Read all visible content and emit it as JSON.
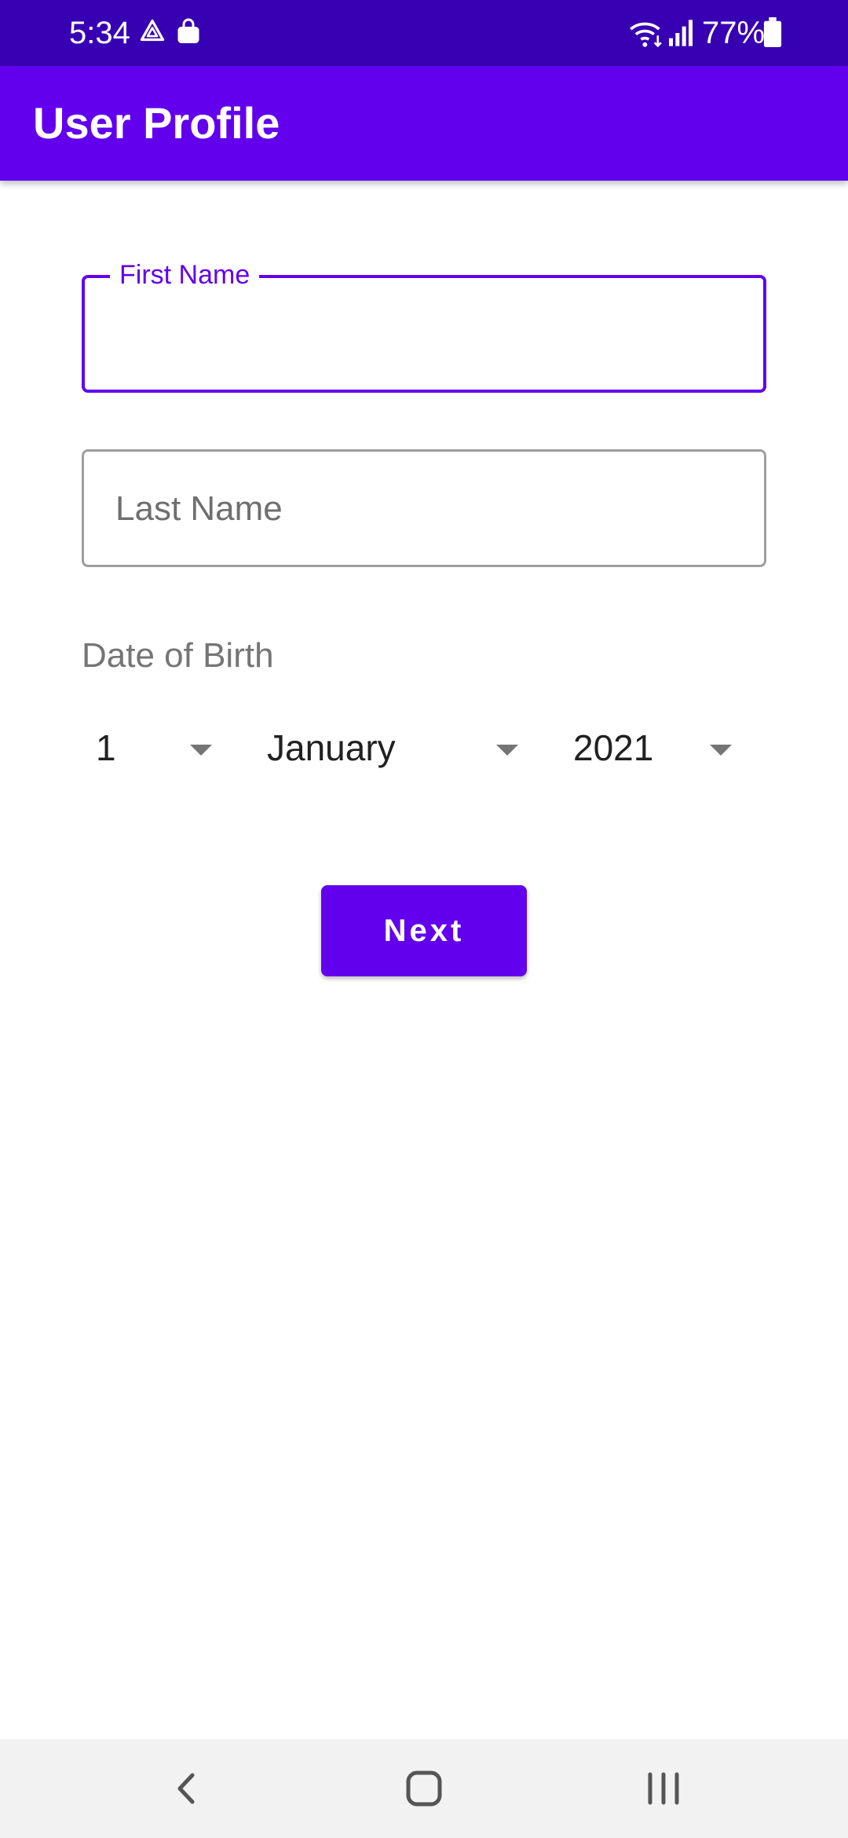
{
  "status_bar": {
    "time": "5:34",
    "battery": "77%",
    "icons": [
      "drive-icon",
      "shopping-bag-icon",
      "wifi-icon",
      "signal-icon",
      "battery-icon"
    ]
  },
  "app_bar": {
    "title": "User Profile",
    "color": "#6200ee"
  },
  "form": {
    "first_name": {
      "label": "First Name",
      "value": "",
      "focused": true
    },
    "last_name": {
      "placeholder": "Last Name",
      "value": ""
    },
    "dob": {
      "label": "Date of Birth",
      "day": "1",
      "month": "January",
      "year": "2021"
    },
    "next_label": "Next"
  },
  "nav_bar": {
    "icons": [
      "back-icon",
      "home-icon",
      "recents-icon"
    ]
  },
  "colors": {
    "primary": "#6200ee",
    "primary_dark": "#3700b3"
  }
}
